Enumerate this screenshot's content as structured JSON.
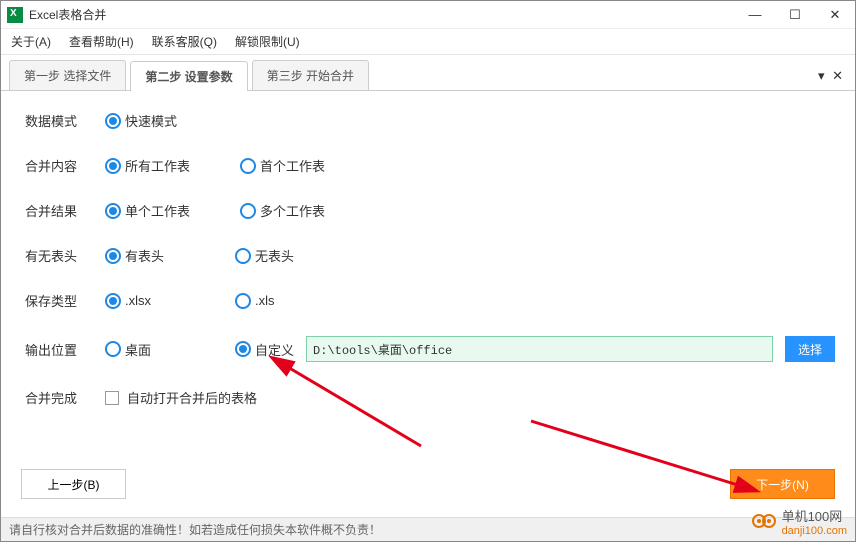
{
  "window": {
    "title": "Excel表格合并"
  },
  "menu": {
    "about": "关于(A)",
    "help": "查看帮助(H)",
    "contact": "联系客服(Q)",
    "unlock": "解锁限制(U)"
  },
  "tabs": {
    "t1": "第一步 选择文件",
    "t2": "第二步 设置参数",
    "t3": "第三步 开始合并"
  },
  "labels": {
    "data_mode": "数据模式",
    "merge_content": "合并内容",
    "merge_result": "合并结果",
    "has_header": "有无表头",
    "save_type": "保存类型",
    "output_location": "输出位置",
    "after_merge": "合并完成"
  },
  "options": {
    "fast_mode": "快速模式",
    "all_sheets": "所有工作表",
    "first_sheet": "首个工作表",
    "single_sheet": "单个工作表",
    "multi_sheet": "多个工作表",
    "has_header_yes": "有表头",
    "has_header_no": "无表头",
    "xlsx": ".xlsx",
    "xls": ".xls",
    "desktop": "桌面",
    "custom": "自定义",
    "auto_open": "自动打开合并后的表格"
  },
  "path_value": "D:\\tools\\桌面\\office",
  "buttons": {
    "select": "选择",
    "prev": "上一步(B)",
    "next": "下一步(N)"
  },
  "status": "请自行核对合并后数据的准确性！如若造成任何损失本软件概不负责！",
  "watermark": {
    "text": "单机100网",
    "domain": "danji100.com"
  }
}
